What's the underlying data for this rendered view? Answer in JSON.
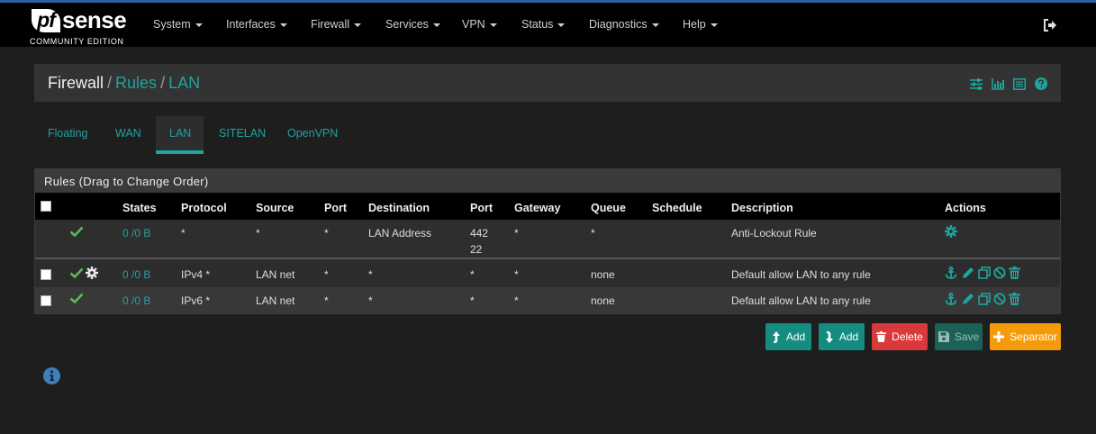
{
  "brand": {
    "name": "pfsense",
    "pf": "pf",
    "sense": "sense",
    "edition": "COMMUNITY EDITION"
  },
  "nav": [
    {
      "label": "System"
    },
    {
      "label": "Interfaces"
    },
    {
      "label": "Firewall"
    },
    {
      "label": "Services"
    },
    {
      "label": "VPN"
    },
    {
      "label": "Status"
    },
    {
      "label": "Diagnostics"
    },
    {
      "label": "Help"
    }
  ],
  "breadcrumb": {
    "part1": "Firewall",
    "sep": "/",
    "part2": "Rules",
    "part3": "LAN"
  },
  "header_icons": [
    "sliders-icon",
    "bar-chart-icon",
    "table-list-icon",
    "help-icon"
  ],
  "tabs": [
    {
      "label": "Floating"
    },
    {
      "label": "WAN"
    },
    {
      "label": "LAN",
      "active": true
    },
    {
      "label": "SITELAN"
    },
    {
      "label": "OpenVPN"
    }
  ],
  "panel": {
    "title": "Rules (Drag to Change Order)"
  },
  "columns": {
    "states": "States",
    "protocol": "Protocol",
    "source": "Source",
    "port": "Port",
    "destination": "Destination",
    "dport": "Port",
    "gateway": "Gateway",
    "queue": "Queue",
    "schedule": "Schedule",
    "description": "Description",
    "actions": "Actions"
  },
  "rules": [
    {
      "states": "0 /0 B",
      "protocol": "*",
      "source": "*",
      "port": "*",
      "destination": "LAN Address",
      "dport1": "442",
      "dport2": "22",
      "gateway": "*",
      "queue": "*",
      "schedule": "",
      "description": "Anti-Lockout Rule"
    },
    {
      "states": "0 /0 B",
      "protocol": "IPv4 *",
      "source": "LAN net",
      "port": "*",
      "destination": "*",
      "dport1": "*",
      "dport2": "",
      "gateway": "*",
      "queue": "none",
      "schedule": "",
      "description": "Default allow LAN to any rule"
    },
    {
      "states": "0 /0 B",
      "protocol": "IPv6 *",
      "source": "LAN net",
      "port": "*",
      "destination": "*",
      "dport1": "*",
      "dport2": "",
      "gateway": "*",
      "queue": "none",
      "schedule": "",
      "description": "Default allow LAN to any rule"
    }
  ],
  "buttons": {
    "add_top": "Add",
    "add_bottom": "Add",
    "delete": "Delete",
    "save": "Save",
    "separator": "Separator"
  },
  "colors": {
    "accent": "#20a39e",
    "pass": "#5cb85c",
    "add": "#148c80",
    "delete": "#d9393b",
    "save": "#1b6158",
    "separator": "#f59b0b",
    "info": "#3d7fbf"
  }
}
